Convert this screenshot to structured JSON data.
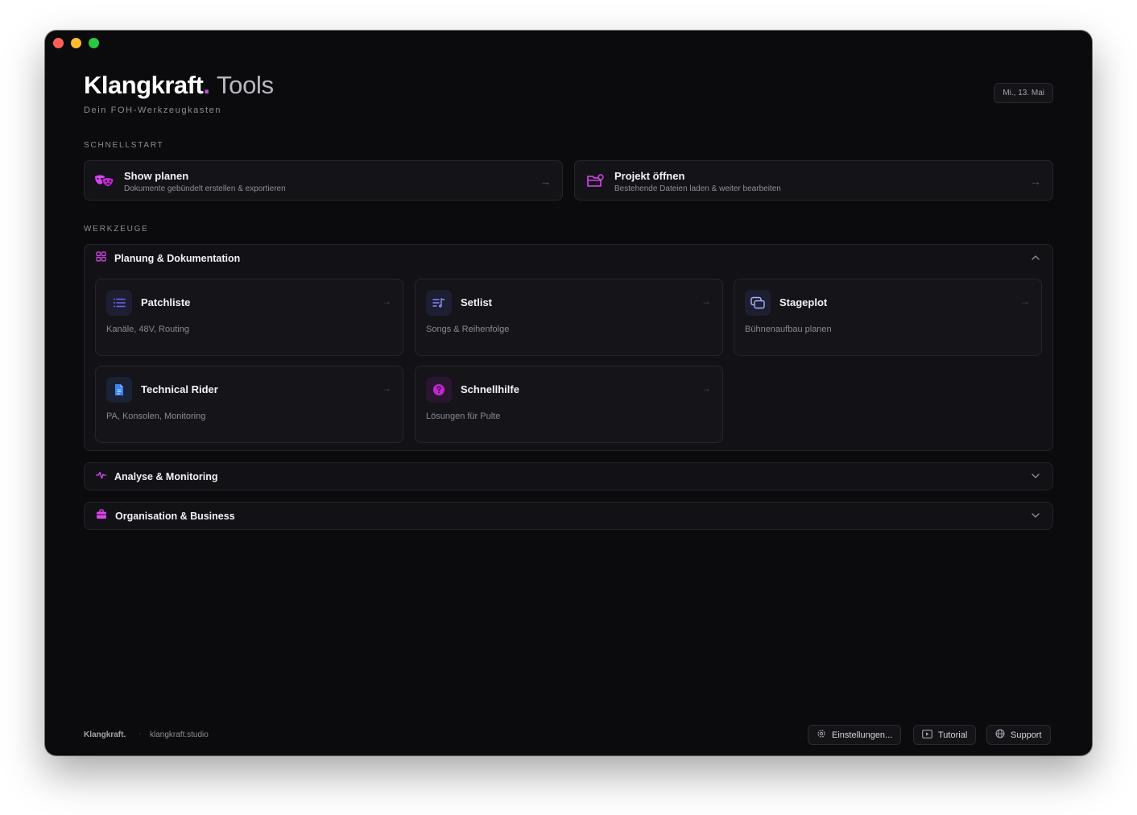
{
  "header": {
    "brand": "Klangkraft",
    "brand_dot": ".",
    "product": "Tools",
    "tagline": "Dein FOH-Werkzeugkasten",
    "date": "Mi., 13. Mai"
  },
  "quickstart": {
    "label": "SCHNELLSTART",
    "items": [
      {
        "title": "Show planen",
        "subtitle": "Dokumente gebündelt erstellen & exportieren",
        "icon": "theater-masks-icon"
      },
      {
        "title": "Projekt öffnen",
        "subtitle": "Bestehende Dateien laden & weiter bearbeiten",
        "icon": "folder-open-icon"
      }
    ]
  },
  "tools": {
    "label": "WERKZEUGE",
    "groups": [
      {
        "title": "Planung & Dokumentation",
        "icon": "grid-icon",
        "expanded": true,
        "items": [
          {
            "title": "Patchliste",
            "desc": "Kanäle, 48V, Routing",
            "icon": "list-icon"
          },
          {
            "title": "Setlist",
            "desc": "Songs & Reihenfolge",
            "icon": "music-list-icon"
          },
          {
            "title": "Stageplot",
            "desc": "Bühnenaufbau planen",
            "icon": "layers-icon"
          },
          {
            "title": "Technical Rider",
            "desc": "PA, Konsolen, Monitoring",
            "icon": "document-icon"
          },
          {
            "title": "Schnellhilfe",
            "desc": "Lösungen für Pulte",
            "icon": "help-icon"
          }
        ]
      },
      {
        "title": "Analyse & Monitoring",
        "icon": "pulse-icon",
        "expanded": false
      },
      {
        "title": "Organisation & Business",
        "icon": "briefcase-icon",
        "expanded": false
      }
    ]
  },
  "footer": {
    "brand": "Klangkraft.",
    "separator": "·",
    "link": "klangkraft.studio",
    "buttons": [
      {
        "label": "Einstellungen...",
        "icon": "gear-icon"
      },
      {
        "label": "Tutorial",
        "icon": "play-icon"
      },
      {
        "label": "Support",
        "icon": "globe-icon"
      }
    ]
  },
  "colors": {
    "accent": "#d946ef",
    "background": "#0b0b0d",
    "card": "#141418"
  }
}
